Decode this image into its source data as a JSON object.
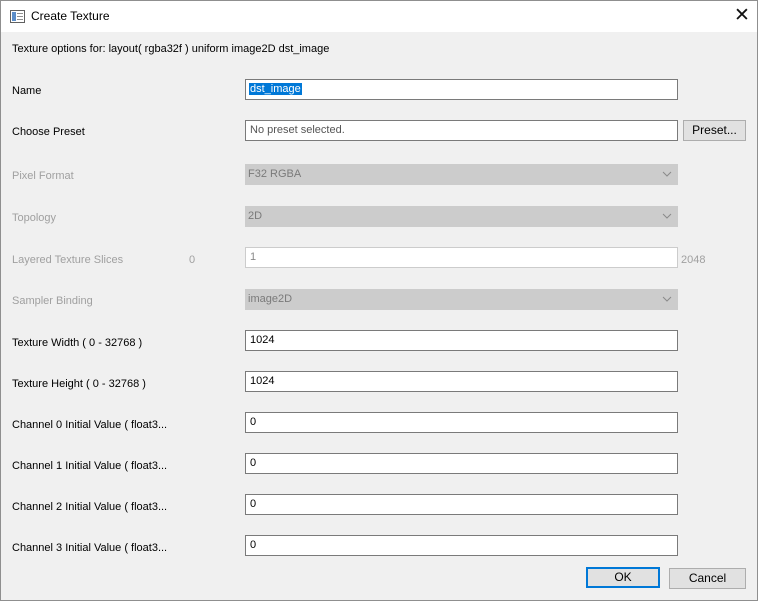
{
  "window": {
    "title": "Create Texture",
    "close_glyph": "✕"
  },
  "header": "Texture options for: layout( rgba32f ) uniform image2D dst_image",
  "rows": {
    "name": {
      "label": "Name",
      "value": "dst_image"
    },
    "preset": {
      "label": "Choose Preset",
      "placeholder": "No preset selected.",
      "button": "Preset..."
    },
    "pixel_format": {
      "label": "Pixel Format",
      "value": "F32 RGBA"
    },
    "topology": {
      "label": "Topology",
      "value": "2D"
    },
    "layers": {
      "label": "Layered Texture Slices",
      "min": "0",
      "value": "1",
      "max": "2048"
    },
    "sampler": {
      "label": "Sampler Binding",
      "value": "image2D"
    },
    "width": {
      "label": "Texture Width ( 0 - 32768 )",
      "value": "1024"
    },
    "height": {
      "label": "Texture Height ( 0 - 32768 )",
      "value": "1024"
    },
    "ch0": {
      "label": "Channel 0 Initial Value ( float3...",
      "value": "0"
    },
    "ch1": {
      "label": "Channel 1 Initial Value ( float3...",
      "value": "0"
    },
    "ch2": {
      "label": "Channel 2 Initial Value ( float3...",
      "value": "0"
    },
    "ch3": {
      "label": "Channel 3 Initial Value ( float3...",
      "value": "0"
    }
  },
  "buttons": {
    "ok": "OK",
    "cancel": "Cancel"
  },
  "colors": {
    "selection": "#0078d7",
    "disabled_text": "#a0a0a0",
    "default_button_border": "#0078d7"
  }
}
